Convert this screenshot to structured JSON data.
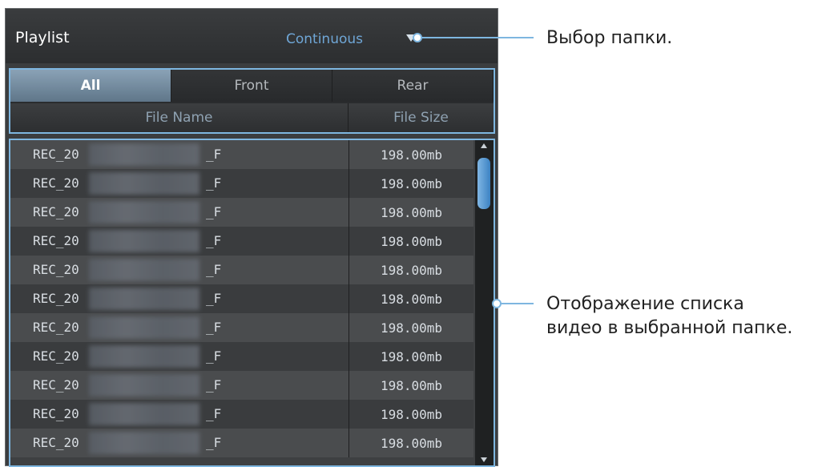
{
  "playlist": {
    "title": "Playlist",
    "mode": "Continuous",
    "tabs": [
      {
        "label": "All",
        "active": true
      },
      {
        "label": "Front",
        "active": false
      },
      {
        "label": "Rear",
        "active": false
      }
    ],
    "columns": {
      "name": "File Name",
      "size": "File Size"
    },
    "rows": [
      {
        "prefix": "REC_20",
        "suffix": "_F",
        "size": "198.00mb"
      },
      {
        "prefix": "REC_20",
        "suffix": "_F",
        "size": "198.00mb"
      },
      {
        "prefix": "REC_20",
        "suffix": "_F",
        "size": "198.00mb"
      },
      {
        "prefix": "REC_20",
        "suffix": "_F",
        "size": "198.00mb"
      },
      {
        "prefix": "REC_20",
        "suffix": "_F",
        "size": "198.00mb"
      },
      {
        "prefix": "REC_20",
        "suffix": "_F",
        "size": "198.00mb"
      },
      {
        "prefix": "REC_20",
        "suffix": "_F",
        "size": "198.00mb"
      },
      {
        "prefix": "REC_20",
        "suffix": "_F",
        "size": "198.00mb"
      },
      {
        "prefix": "REC_20",
        "suffix": "_F",
        "size": "198.00mb"
      },
      {
        "prefix": "REC_20",
        "suffix": "_F",
        "size": "198.00mb"
      },
      {
        "prefix": "REC_20",
        "suffix": "_F",
        "size": "198.00mb"
      }
    ]
  },
  "callouts": {
    "folder_select": "Выбор папки.",
    "list_line1": "Отображение списка",
    "list_line2": "видео в выбранной папке."
  },
  "colors": {
    "accent": "#7eb6e0",
    "mode_text": "#6fa6d6",
    "scroll_thumb": "#3c82c3"
  }
}
